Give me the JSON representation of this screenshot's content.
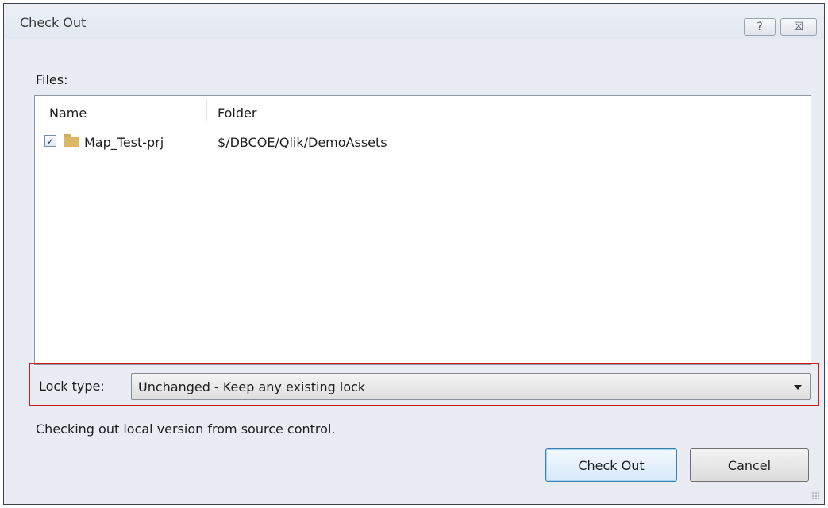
{
  "dialog": {
    "title": "Check Out",
    "help_label": "?",
    "close_label": "☒"
  },
  "files": {
    "label": "Files:",
    "columns": {
      "name": "Name",
      "folder": "Folder"
    },
    "rows": [
      {
        "checked": true,
        "icon": "folder-icon",
        "name": "Map_Test-prj",
        "folder": "$/DBCOE/Qlik/DemoAssets"
      }
    ]
  },
  "lock": {
    "label": "Lock type:",
    "selected": "Unchanged - Keep any existing lock"
  },
  "status": "Checking out local version from source control.",
  "buttons": {
    "checkout": "Check Out",
    "cancel": "Cancel"
  },
  "colors": {
    "highlight_border": "#d11c1c",
    "default_button": "#3c7fb1"
  }
}
